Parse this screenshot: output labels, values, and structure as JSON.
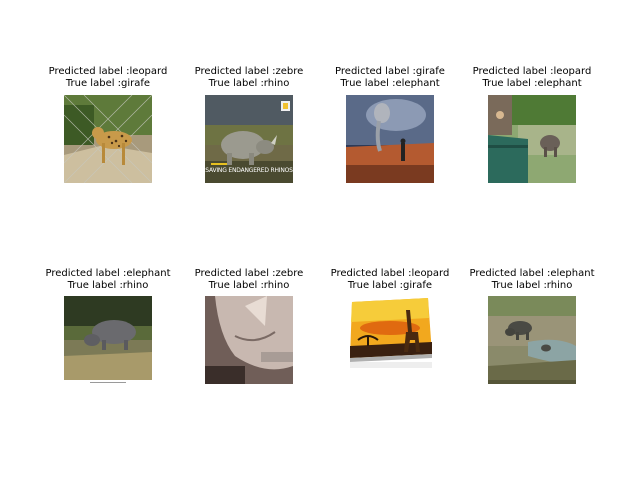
{
  "figure": {
    "panels": [
      {
        "predicted": "Predicted label :leopard",
        "true": "True label :girafe",
        "scene": "leopard-in-enclosure"
      },
      {
        "predicted": "Predicted label :zebre",
        "true": "True label :rhino",
        "scene": "rhino-poster",
        "overlay_text": "SAVING ENDANGERED RHINOS"
      },
      {
        "predicted": "Predicted label :girafe",
        "true": "True label :elephant",
        "scene": "elephant-surreal-sky"
      },
      {
        "predicted": "Predicted label :leopard",
        "true": "True label :elephant",
        "scene": "elephant-near-fence"
      },
      {
        "predicted": "Predicted label :elephant",
        "true": "True label :rhino",
        "scene": "rhino-grazing"
      },
      {
        "predicted": "Predicted label :zebre",
        "true": "True label :rhino",
        "scene": "rhino-closeup-sepia"
      },
      {
        "predicted": "Predicted label :leopard",
        "true": "True label :girafe",
        "scene": "giraffe-sunset-canvas"
      },
      {
        "predicted": "Predicted label :elephant",
        "true": "True label :rhino",
        "scene": "rhino-at-waterhole"
      }
    ]
  }
}
